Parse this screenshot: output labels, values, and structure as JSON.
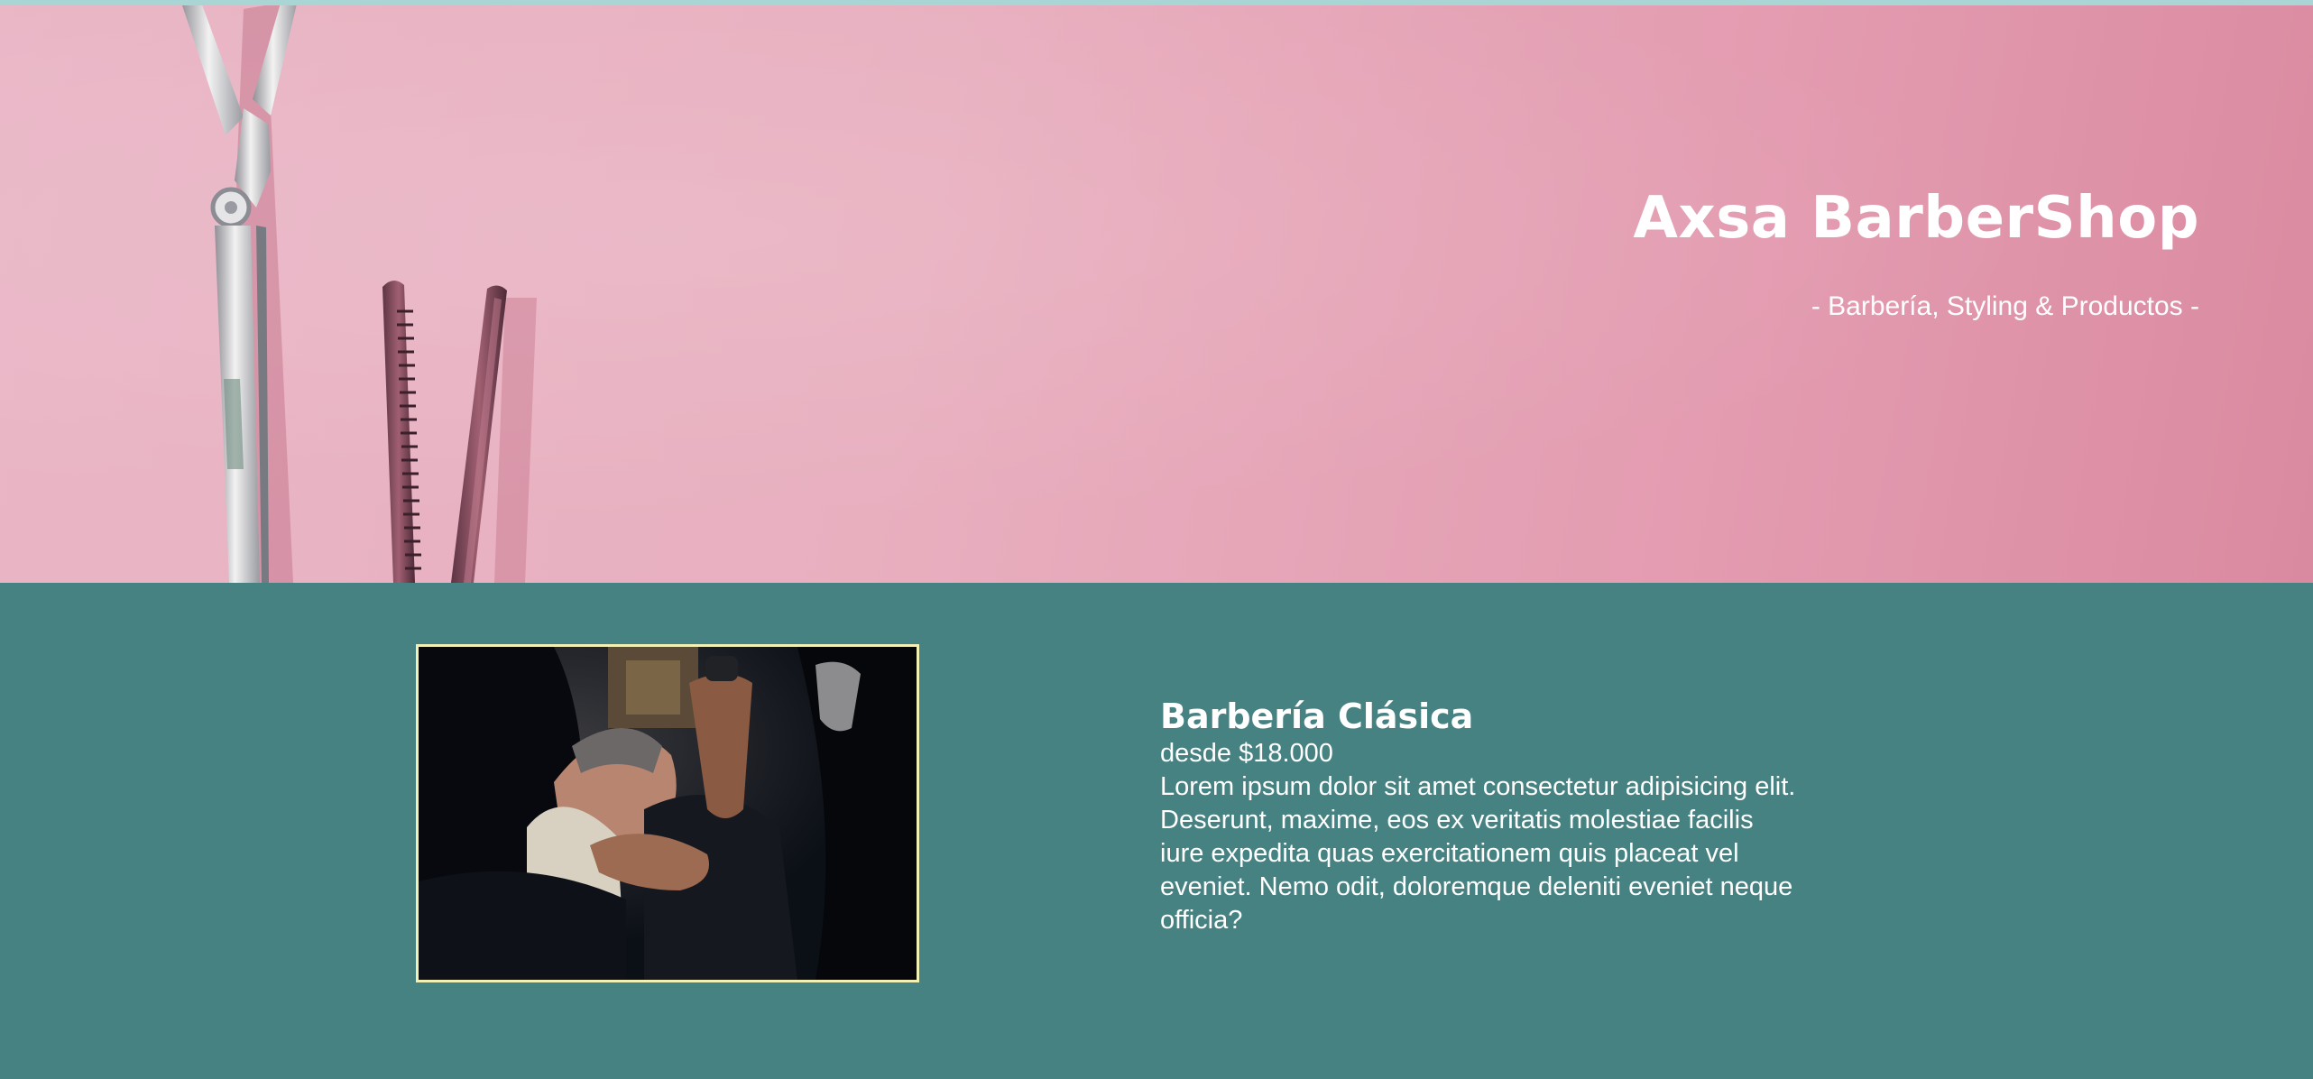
{
  "hero": {
    "title": "Axsa BarberShop",
    "subtitle": "- Barbería, Styling & Productos -",
    "background_color": "#e5a9bb"
  },
  "service": {
    "title": "Barbería Clásica",
    "price": "desde $18.000",
    "description": "Lorem ipsum dolor sit amet consectetur adipisicing elit. Deserunt, maxime, eos ex veritatis molestiae facilis iure expedita quas exercitationem quis placeat vel eveniet. Nemo odit, doloremque deleniti eveniet neque officia?",
    "background_color": "#478282",
    "photo_border_color": "#f3f0b5"
  }
}
